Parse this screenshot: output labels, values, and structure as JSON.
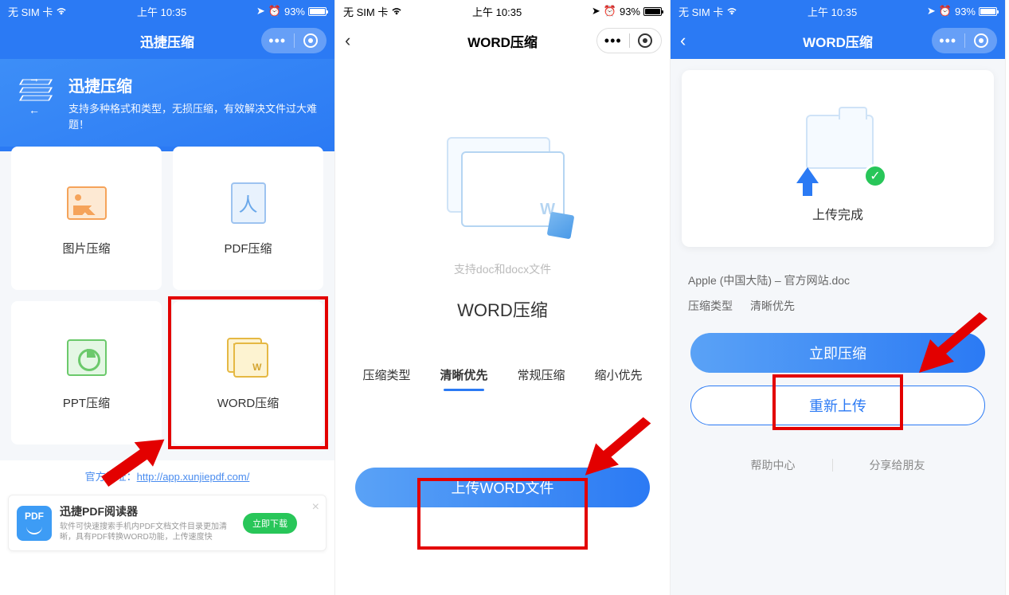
{
  "status": {
    "carrier": "无 SIM 卡",
    "time": "上午 10:35",
    "battery_pct": "93%"
  },
  "screen1": {
    "navTitle": "迅捷压缩",
    "heroTitle": "迅捷压缩",
    "heroDesc": "支持多种格式和类型，无损压缩，有效解决文件过大难题！",
    "cards": {
      "img": "图片压缩",
      "pdf": "PDF压缩",
      "ppt": "PPT压缩",
      "word": "WORD压缩"
    },
    "officialLabel": "官方地址：",
    "officialUrl": "http://app.xunjiepdf.com/",
    "banner": {
      "title": "迅捷PDF阅读器",
      "sub": "软件可快速搜索手机内PDF文档文件目录更加清晰，具有PDF转换WORD功能，上传速度快",
      "btn": "立即下载"
    }
  },
  "screen2": {
    "navTitle": "WORD压缩",
    "sub": "支持doc和docx文件",
    "title": "WORD压缩",
    "tabs": {
      "label": "压缩类型",
      "opt1": "清晰优先",
      "opt2": "常规压缩",
      "opt3": "缩小优先"
    },
    "uploadBtn": "上传WORD文件"
  },
  "screen3": {
    "navTitle": "WORD压缩",
    "uploadStatus": "上传完成",
    "fileName": "Apple (中国大陆) – 官方网站.doc",
    "typeLabel": "压缩类型",
    "typeValue": "清晰优先",
    "compressBtn": "立即压缩",
    "reuploadBtn": "重新上传",
    "help": "帮助中心",
    "share": "分享给朋友"
  }
}
